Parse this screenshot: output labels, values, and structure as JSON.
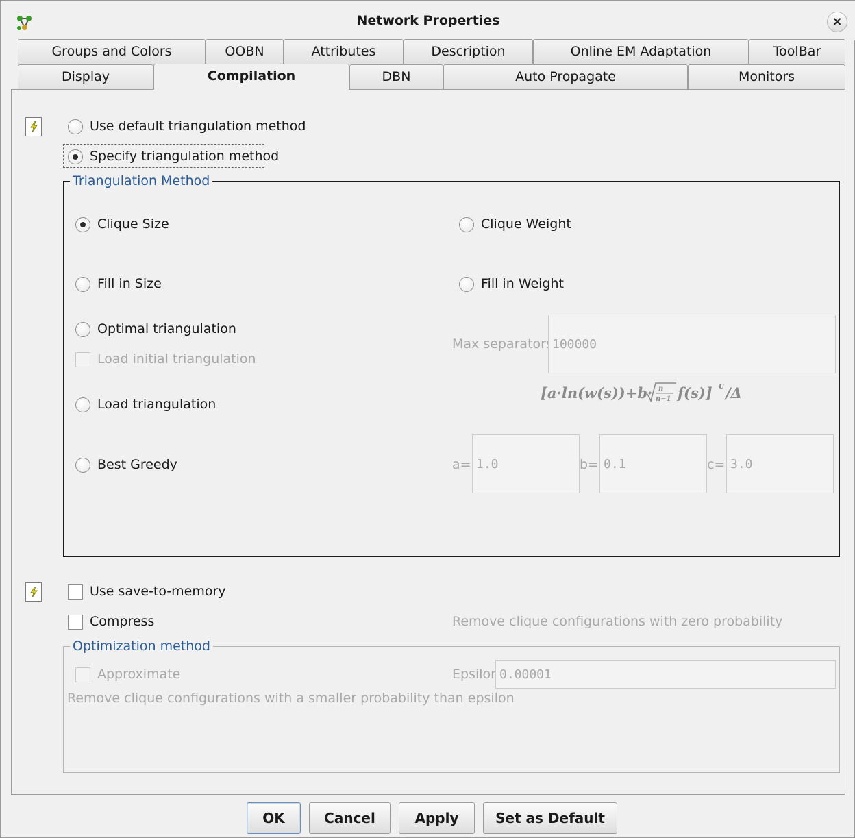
{
  "window": {
    "title": "Network Properties",
    "close_glyph": "×"
  },
  "tabs": {
    "row1": [
      "Groups and Colors",
      "OOBN",
      "Attributes",
      "Description",
      "Online EM Adaptation",
      "ToolBar"
    ],
    "row2": [
      "Display",
      "Compilation",
      "DBN",
      "Auto Propagate",
      "Monitors"
    ],
    "active": "Compilation"
  },
  "triangulation_choice": {
    "default_label": "Use default triangulation method",
    "specify_label": "Specify triangulation method",
    "selected": "specify"
  },
  "triangulation_method": {
    "legend": "Triangulation Method",
    "options": {
      "clique_size": "Clique Size",
      "clique_weight": "Clique Weight",
      "fill_in_size": "Fill in Size",
      "fill_in_weight": "Fill in Weight",
      "optimal": "Optimal triangulation",
      "load_initial": "Load initial triangulation",
      "load": "Load triangulation",
      "best_greedy": "Best Greedy"
    },
    "selected": "clique_size",
    "max_separators_label": "Max separators",
    "max_separators_value": "100000",
    "formula_text": "[a·ln(w(s))+b·√(n/(n−1)) f(s)]ᶜ/Δ",
    "params": {
      "a_label": "a=",
      "a_value": "1.0",
      "b_label": "b=",
      "b_value": "0.1",
      "c_label": "c=",
      "c_value": "3.0"
    }
  },
  "memory": {
    "save_to_memory_label": "Use save-to-memory",
    "save_to_memory_checked": false,
    "compress_label": "Compress",
    "compress_checked": false,
    "compress_hint": "Remove clique configurations with zero probability"
  },
  "optimization": {
    "legend": "Optimization method",
    "approximate_label": "Approximate",
    "approximate_checked": false,
    "epsilon_label": "Epsilon",
    "epsilon_value": "0.00001",
    "hint": "Remove clique configurations with a smaller probability than epsilon"
  },
  "buttons": {
    "ok": "OK",
    "cancel": "Cancel",
    "apply": "Apply",
    "set_default": "Set as Default"
  },
  "colors": {
    "legend_blue": "#2a5d97",
    "app_icon_green": "#3a9a2a",
    "bolt_yellow": "#e8d020"
  },
  "icons": {
    "app": "network-icon",
    "doc1": "compile-document-icon",
    "doc2": "memory-document-icon"
  }
}
